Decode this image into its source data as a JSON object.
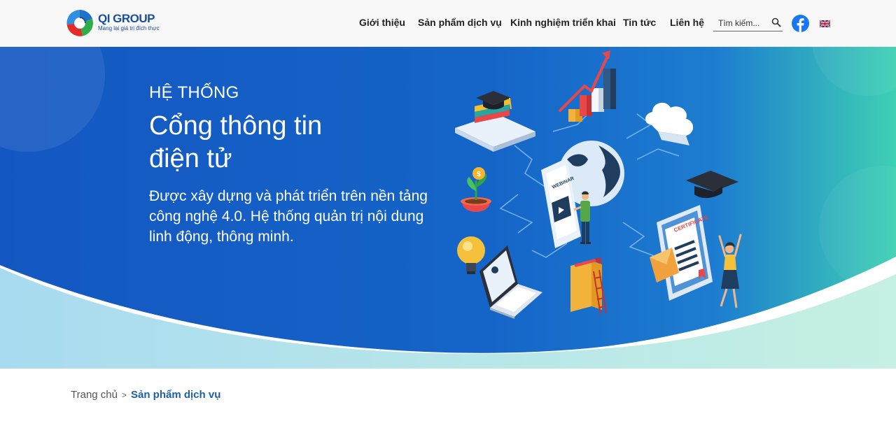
{
  "brand": {
    "name": "QI GROUP",
    "tagline": "Mang lại giá trị đích thực"
  },
  "nav": {
    "items": [
      {
        "label": "Giới thiệu"
      },
      {
        "label": "Sản phẩm dịch vụ"
      },
      {
        "label": "Kinh nghiệm triển khai"
      },
      {
        "label": "Tin tức"
      },
      {
        "label": "Liên hệ"
      }
    ]
  },
  "search": {
    "placeholder": "Tìm kiếm..."
  },
  "icons": {
    "search": "search-icon",
    "social": "facebook-icon",
    "language": "uk-flag-icon"
  },
  "hero": {
    "eyebrow": "HỆ THỐNG",
    "title_line1": "Cổng thông tin",
    "title_line2": "điện tử",
    "description": "Được xây dựng và phát triển trên nền tảng công nghệ 4.0. Hệ thống quản trị nội dung linh động, thông minh.",
    "illustration_labels": {
      "webinar": "WEBINAR",
      "certificate": "CERTIFICATE"
    }
  },
  "breadcrumb": {
    "home": "Trang chủ",
    "separator": ">",
    "current": "Sản phẩm dịch vụ"
  },
  "colors": {
    "primary": "#1b4f9c",
    "banner_blue": "#1565c8",
    "banner_teal": "#3ed0b4",
    "breadcrumb_active": "#1c5fb0",
    "facebook": "#1877f2"
  }
}
